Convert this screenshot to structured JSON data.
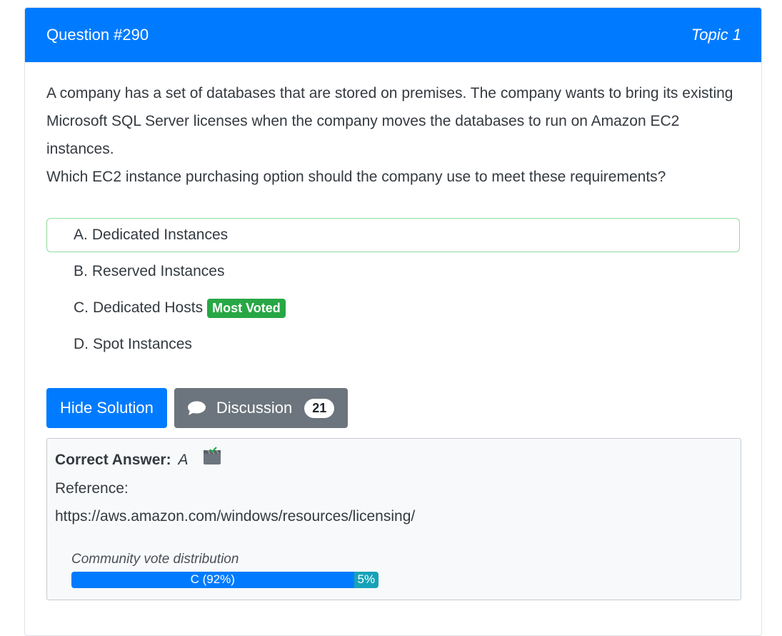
{
  "header": {
    "question_number": "Question #290",
    "topic": "Topic 1"
  },
  "question": {
    "paragraph1": "A company has a set of databases that are stored on premises. The company wants to bring its existing Microsoft SQL Server licenses when the company moves the databases to run on Amazon EC2 instances.",
    "paragraph2": "Which EC2 instance purchasing option should the company use to meet these requirements?"
  },
  "choices": [
    {
      "letter": "A.",
      "text": "Dedicated Instances"
    },
    {
      "letter": "B.",
      "text": "Reserved Instances"
    },
    {
      "letter": "C.",
      "text": "Dedicated Hosts"
    },
    {
      "letter": "D.",
      "text": "Spot Instances"
    }
  ],
  "most_voted_label": "Most Voted",
  "buttons": {
    "hide_solution": "Hide Solution",
    "discussion": "Discussion",
    "discussion_count": "21"
  },
  "answer": {
    "label": "Correct Answer:",
    "value": "A",
    "reference_label": "Reference:",
    "reference_url": "https://aws.amazon.com/windows/resources/licensing/"
  },
  "votes": {
    "title": "Community vote distribution",
    "segments": [
      {
        "label": "C (92%)",
        "percent": 92,
        "color": "#007bff"
      },
      {
        "label": "5%",
        "percent": 8,
        "color": "#17a2b8"
      }
    ]
  },
  "colors": {
    "primary": "#007bff",
    "secondary": "#6c757d",
    "success": "#28a745",
    "info": "#17a2b8"
  },
  "icons": {
    "discussion": "speech-bubble-icon",
    "answer": "clapperboard-check-icon"
  }
}
